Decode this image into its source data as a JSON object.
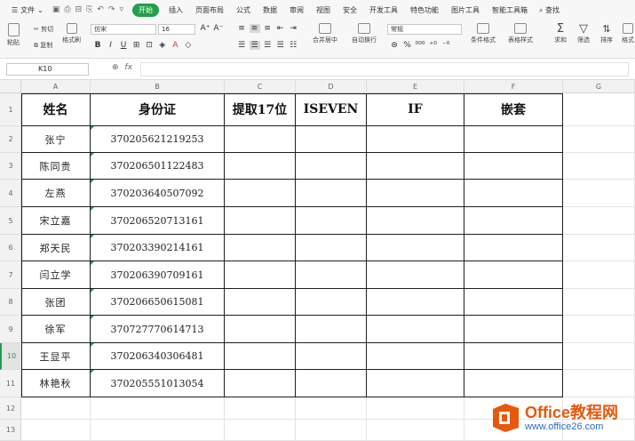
{
  "menubar": {
    "file_label": "文件",
    "start_label": "开始",
    "tabs": [
      "插入",
      "页面布局",
      "公式",
      "数据",
      "审阅",
      "视图",
      "安全",
      "开发工具",
      "特色功能",
      "图片工具",
      "智能工具箱"
    ],
    "search_label": "查找"
  },
  "ribbon": {
    "paste_label": "粘贴",
    "cut_label": "剪切",
    "copy_label": "复制",
    "format_painter_label": "格式刷",
    "font_name": "仿宋",
    "font_size": "16",
    "merge_label": "合并居中",
    "wrap_label": "自动换行",
    "number_format": "常规",
    "cond_format_label": "条件格式",
    "table_style_label": "表格样式",
    "sum_label": "求和",
    "filter_label": "筛选",
    "sort_label": "排序",
    "format_label": "格式"
  },
  "formula_bar": {
    "cell_ref": "K10",
    "fx_label": "fx",
    "content": ""
  },
  "columns": [
    "A",
    "B",
    "C",
    "D",
    "E",
    "F",
    "G"
  ],
  "rows": [
    "1",
    "2",
    "3",
    "4",
    "5",
    "6",
    "7",
    "8",
    "9",
    "10",
    "11",
    "12",
    "13"
  ],
  "table": {
    "headers": [
      "姓名",
      "身份证",
      "提取17位",
      "ISEVEN",
      "IF",
      "嵌套"
    ],
    "records": [
      {
        "name": "张宁",
        "id": "370205621219253"
      },
      {
        "name": "陈同贵",
        "id": "370206501122483"
      },
      {
        "name": "左燕",
        "id": "370203640507092"
      },
      {
        "name": "宋立嘉",
        "id": "370206520713161"
      },
      {
        "name": "郑天民",
        "id": "370203390214161"
      },
      {
        "name": "闫立学",
        "id": "370206390709161"
      },
      {
        "name": "张团",
        "id": "370206650615081"
      },
      {
        "name": "徐军",
        "id": "370727770614713"
      },
      {
        "name": "王显平",
        "id": "370206340306481"
      },
      {
        "name": "林艳秋",
        "id": "370205551013054"
      }
    ]
  },
  "watermark": {
    "title": "Office教程网",
    "url": "www.office26.com"
  },
  "colors": {
    "start_tab": "#22a04b",
    "watermark_orange": "#e8580c",
    "watermark_blue": "#2b6cb8",
    "selected_row_indicator": "#1e9b4f"
  }
}
